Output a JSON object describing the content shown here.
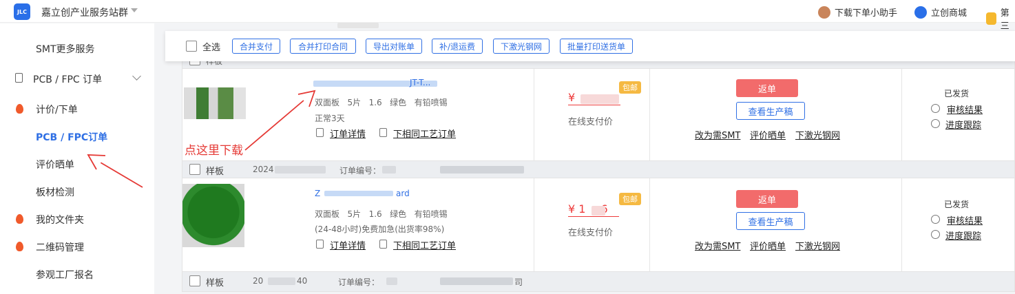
{
  "header": {
    "logo_text": "JLC",
    "brand": "嘉立创产业服务站群",
    "links": [
      "下载下单小助手",
      "立创商城",
      "第三"
    ]
  },
  "sidebar": {
    "items": [
      {
        "label": "SMT更多服务",
        "icon": "none"
      },
      {
        "label": "PCB / FPC 订单",
        "icon": "document-icon",
        "expandable": true
      },
      {
        "label": "计价/下单",
        "icon": "flame-icon"
      },
      {
        "label": "PCB / FPC订单",
        "icon": "none",
        "active": true
      },
      {
        "label": "评价晒单",
        "icon": "none"
      },
      {
        "label": "板材检测",
        "icon": "none"
      },
      {
        "label": "我的文件夹",
        "icon": "flame-icon"
      },
      {
        "label": "二维码管理",
        "icon": "flame-icon"
      },
      {
        "label": "参观工厂报名",
        "icon": "none"
      }
    ]
  },
  "toolbar": {
    "select_all": "全选",
    "buttons": [
      "合并支付",
      "合并打印合同",
      "导出对账单",
      "补/退运费",
      "下激光钢网",
      "批量打印送货单"
    ]
  },
  "orders": [
    {
      "type": "样板",
      "date": "2024",
      "order_no_label": "订单编号：",
      "name_suffix": "JT-T...",
      "spec": [
        "双面板",
        "5片",
        "1.6",
        "绿色",
        "有铅喷锡"
      ],
      "delivery": "正常3天",
      "detail_link": "订单详情",
      "reorder_link": "下相同工艺订单",
      "price_prefix": "¥",
      "free_shipping": "包邮",
      "payment": "在线支付价",
      "return_button": "返单",
      "view_button": "查看生产稿",
      "actions": [
        "改为需SMT",
        "评价晒单",
        "下激光钢网"
      ],
      "status": "已发货",
      "review_link": "审核结果",
      "track_link": "进度跟踪"
    },
    {
      "type": "样板",
      "date": "2024",
      "order_no_label": "订单编号：",
      "name_prefix": "Z",
      "name_suffix": "ard",
      "spec": [
        "双面板",
        "5片",
        "1.6",
        "绿色",
        "有铅喷锡"
      ],
      "delivery": "(24-48小时)免费加急(出货率98%)",
      "detail_link": "订单详情",
      "reorder_link": "下相同工艺订单",
      "price_prefix": "¥ 1",
      "price_suffix": "6",
      "free_shipping": "包邮",
      "payment": "在线支付价",
      "return_button": "返单",
      "view_button": "查看生产稿",
      "actions": [
        "改为需SMT",
        "评价晒单",
        "下激光钢网"
      ],
      "status": "已发货",
      "review_link": "审核结果",
      "track_link": "进度跟踪"
    },
    {
      "type": "样板",
      "date": "20",
      "date_suffix": "40",
      "order_no_label": "订单编号：",
      "company_suffix": "司"
    }
  ],
  "annotation": {
    "text": "点这里下载",
    "color": "#e53935"
  },
  "colors": {
    "accent": "#2f6fe4",
    "price": "#ee3a3a",
    "return_button": "#f26b6b",
    "badge": "#f5b942"
  }
}
